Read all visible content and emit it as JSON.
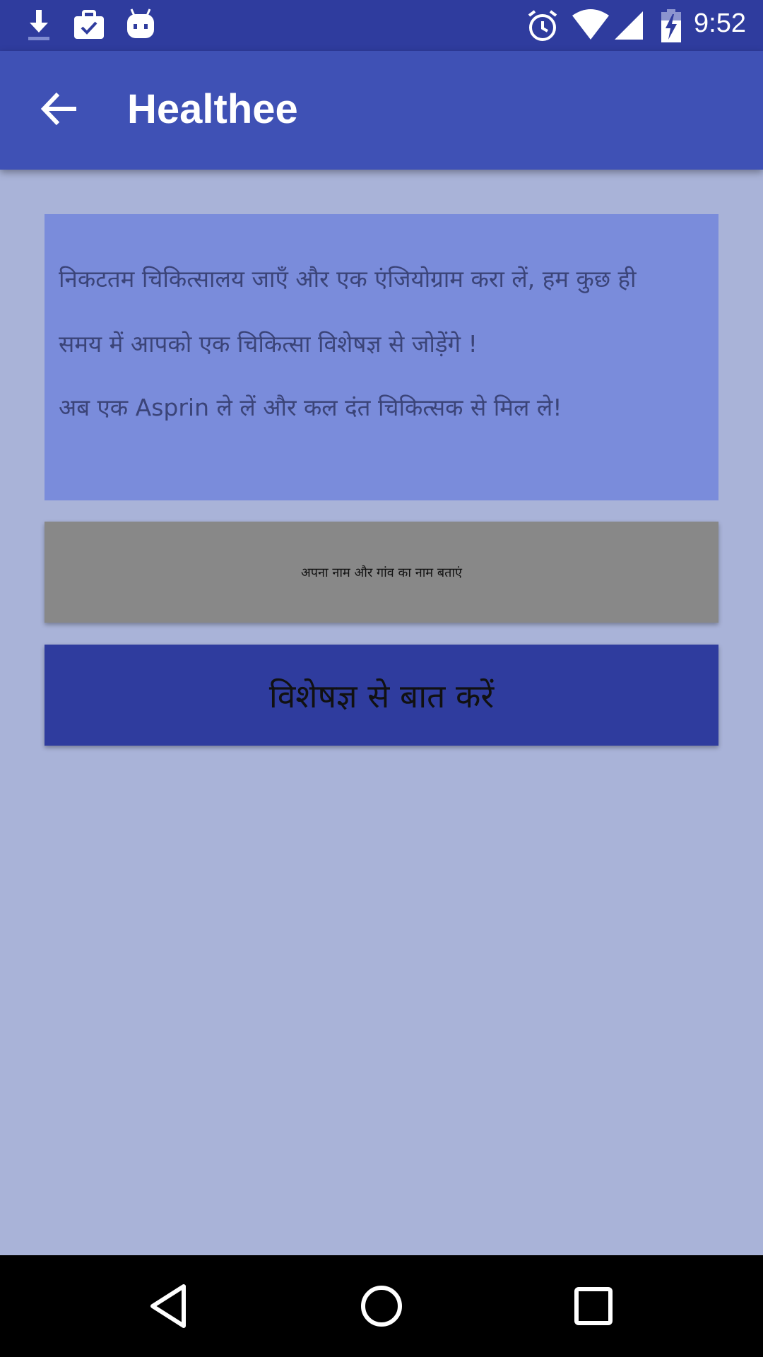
{
  "status_bar": {
    "time": "9:52",
    "left_icons": [
      "download-icon",
      "briefcase-check-icon",
      "android-robot-icon"
    ],
    "right_icons": [
      "alarm-icon",
      "wifi-icon",
      "signal-icon",
      "battery-charging-icon"
    ]
  },
  "app_bar": {
    "title": "Healthee",
    "back_icon": "arrow-left-icon",
    "color": "#3f51b5"
  },
  "message": {
    "lines": [
      " निकटतम चिकित्सालय जाएँ और एक एंजियोग्राम करा लें, हम कुछ ही",
      "समय में आपको  एक चिकित्सा विशेषज्ञ से जोड़ेंगे  !",
      " अब एक Asprin ले लें और कल दंत चिकित्सक से मिल ले!"
    ]
  },
  "name_input": {
    "placeholder": "अपना नाम और गांव का नाम बताएं"
  },
  "expert_button": {
    "label": "विशेषज्ञ से बात करें"
  },
  "nav_bar": {
    "icons": [
      "back-triangle-icon",
      "home-circle-icon",
      "recents-square-icon"
    ]
  },
  "colors": {
    "background": "#a9b3d8",
    "status_bar": "#2f3c9e",
    "card": "#7a8cdb",
    "input": "#888888",
    "button": "#2f3c9e"
  }
}
